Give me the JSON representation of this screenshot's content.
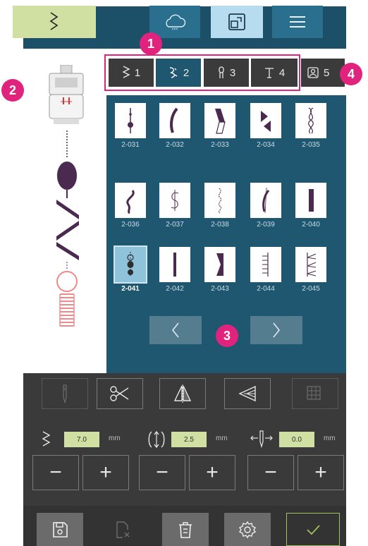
{
  "top_tabs": [
    {
      "name": "stitch-menu",
      "icon": "zigzag-icon"
    },
    {
      "name": "cloud",
      "icon": "cloud-icon"
    },
    {
      "name": "edit",
      "icon": "edit-window-icon"
    },
    {
      "name": "menu",
      "icon": "hamburger-icon"
    }
  ],
  "categories": [
    {
      "num": "1",
      "icon": "zigzag-icon"
    },
    {
      "num": "2",
      "icon": "decorative-stitch-icon"
    },
    {
      "num": "3",
      "icon": "buttonhole-icon"
    },
    {
      "num": "4",
      "icon": "font-icon"
    },
    {
      "num": "5",
      "icon": "personal-stitch-icon"
    }
  ],
  "markers": [
    "1",
    "2",
    "3",
    "4"
  ],
  "stitches": [
    {
      "code": "2-031"
    },
    {
      "code": "2-032"
    },
    {
      "code": "2-033"
    },
    {
      "code": "2-034"
    },
    {
      "code": "2-035"
    },
    {
      "code": "2-036"
    },
    {
      "code": "2-037"
    },
    {
      "code": "2-038"
    },
    {
      "code": "2-039"
    },
    {
      "code": "2-040"
    },
    {
      "code": "2-041"
    },
    {
      "code": "2-042"
    },
    {
      "code": "2-043"
    },
    {
      "code": "2-044"
    },
    {
      "code": "2-045"
    }
  ],
  "selected_stitch": "2-041",
  "settings": {
    "width": {
      "value": "7.0",
      "unit": "mm"
    },
    "length": {
      "value": "2.5",
      "unit": "mm"
    },
    "position": {
      "value": "0.0",
      "unit": "mm"
    },
    "minus": "−",
    "plus": "+"
  },
  "colors": {
    "accent": "#e0237c",
    "panel": "#1f5670",
    "value_box": "#cfe0a2",
    "stitch_preview_dark": "#4a2a4e",
    "stitch_preview_light": "#f08a8a"
  }
}
